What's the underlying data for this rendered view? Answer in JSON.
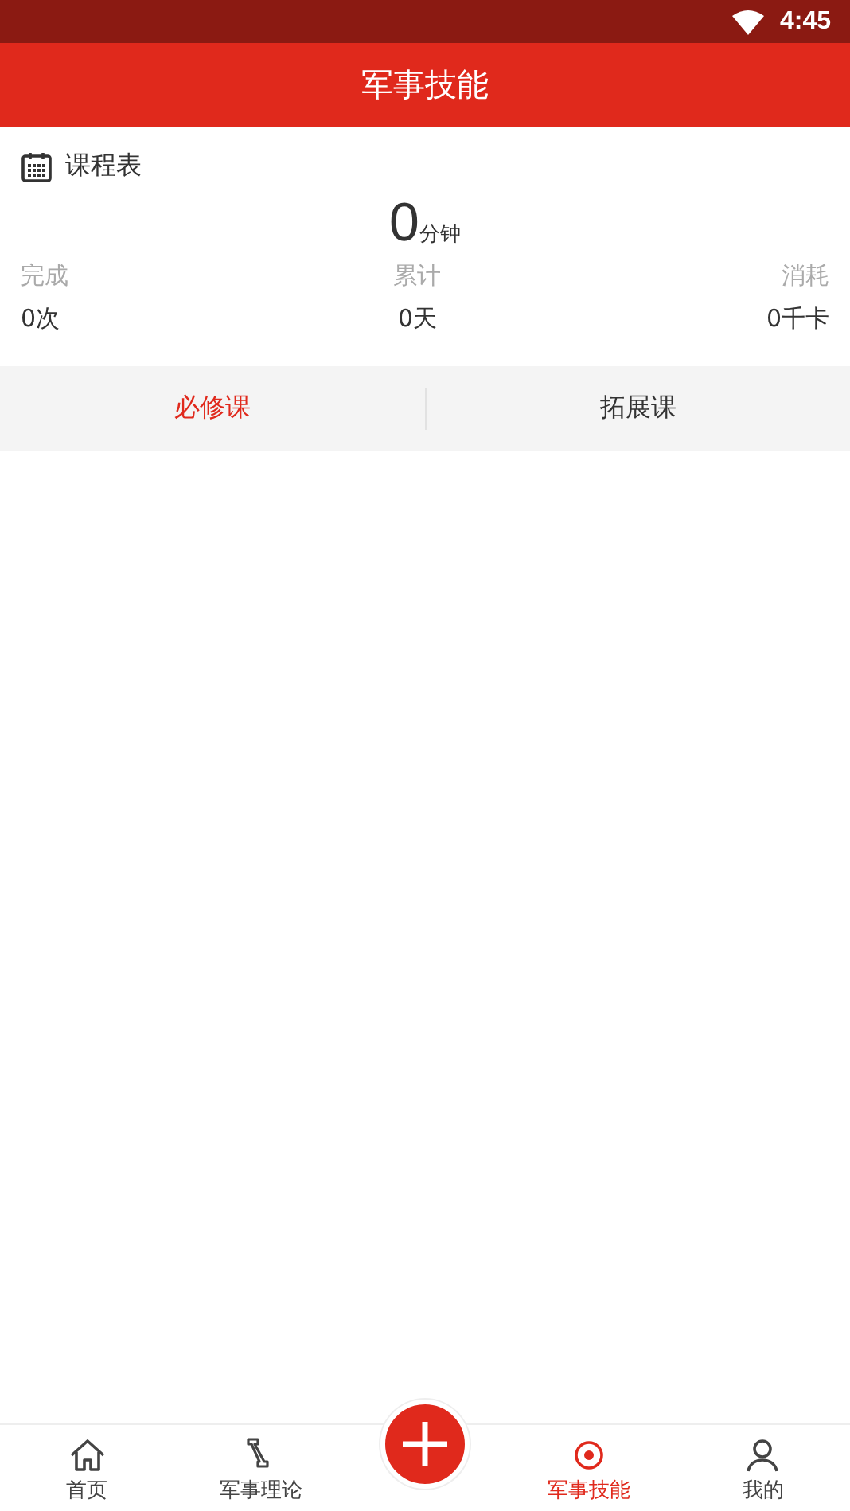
{
  "status_bar": {
    "time": "4:45"
  },
  "header": {
    "title": "军事技能"
  },
  "schedule": {
    "title": "课程表",
    "total_value": "0",
    "total_unit": "分钟",
    "stats": [
      {
        "label": "完成",
        "value": "0次"
      },
      {
        "label": "累计",
        "value": "0天"
      },
      {
        "label": "消耗",
        "value": "0千卡"
      }
    ]
  },
  "tabs": [
    {
      "label": "必修课",
      "selected": true
    },
    {
      "label": "拓展课",
      "selected": false
    }
  ],
  "bottom_nav": [
    {
      "kind": "home",
      "label": "首页",
      "selected": false
    },
    {
      "kind": "theory",
      "label": "军事理论",
      "selected": false
    },
    {
      "kind": "add",
      "selected": false
    },
    {
      "kind": "skill",
      "label": "军事技能",
      "selected": true
    },
    {
      "kind": "me",
      "label": "我的",
      "selected": false
    }
  ]
}
